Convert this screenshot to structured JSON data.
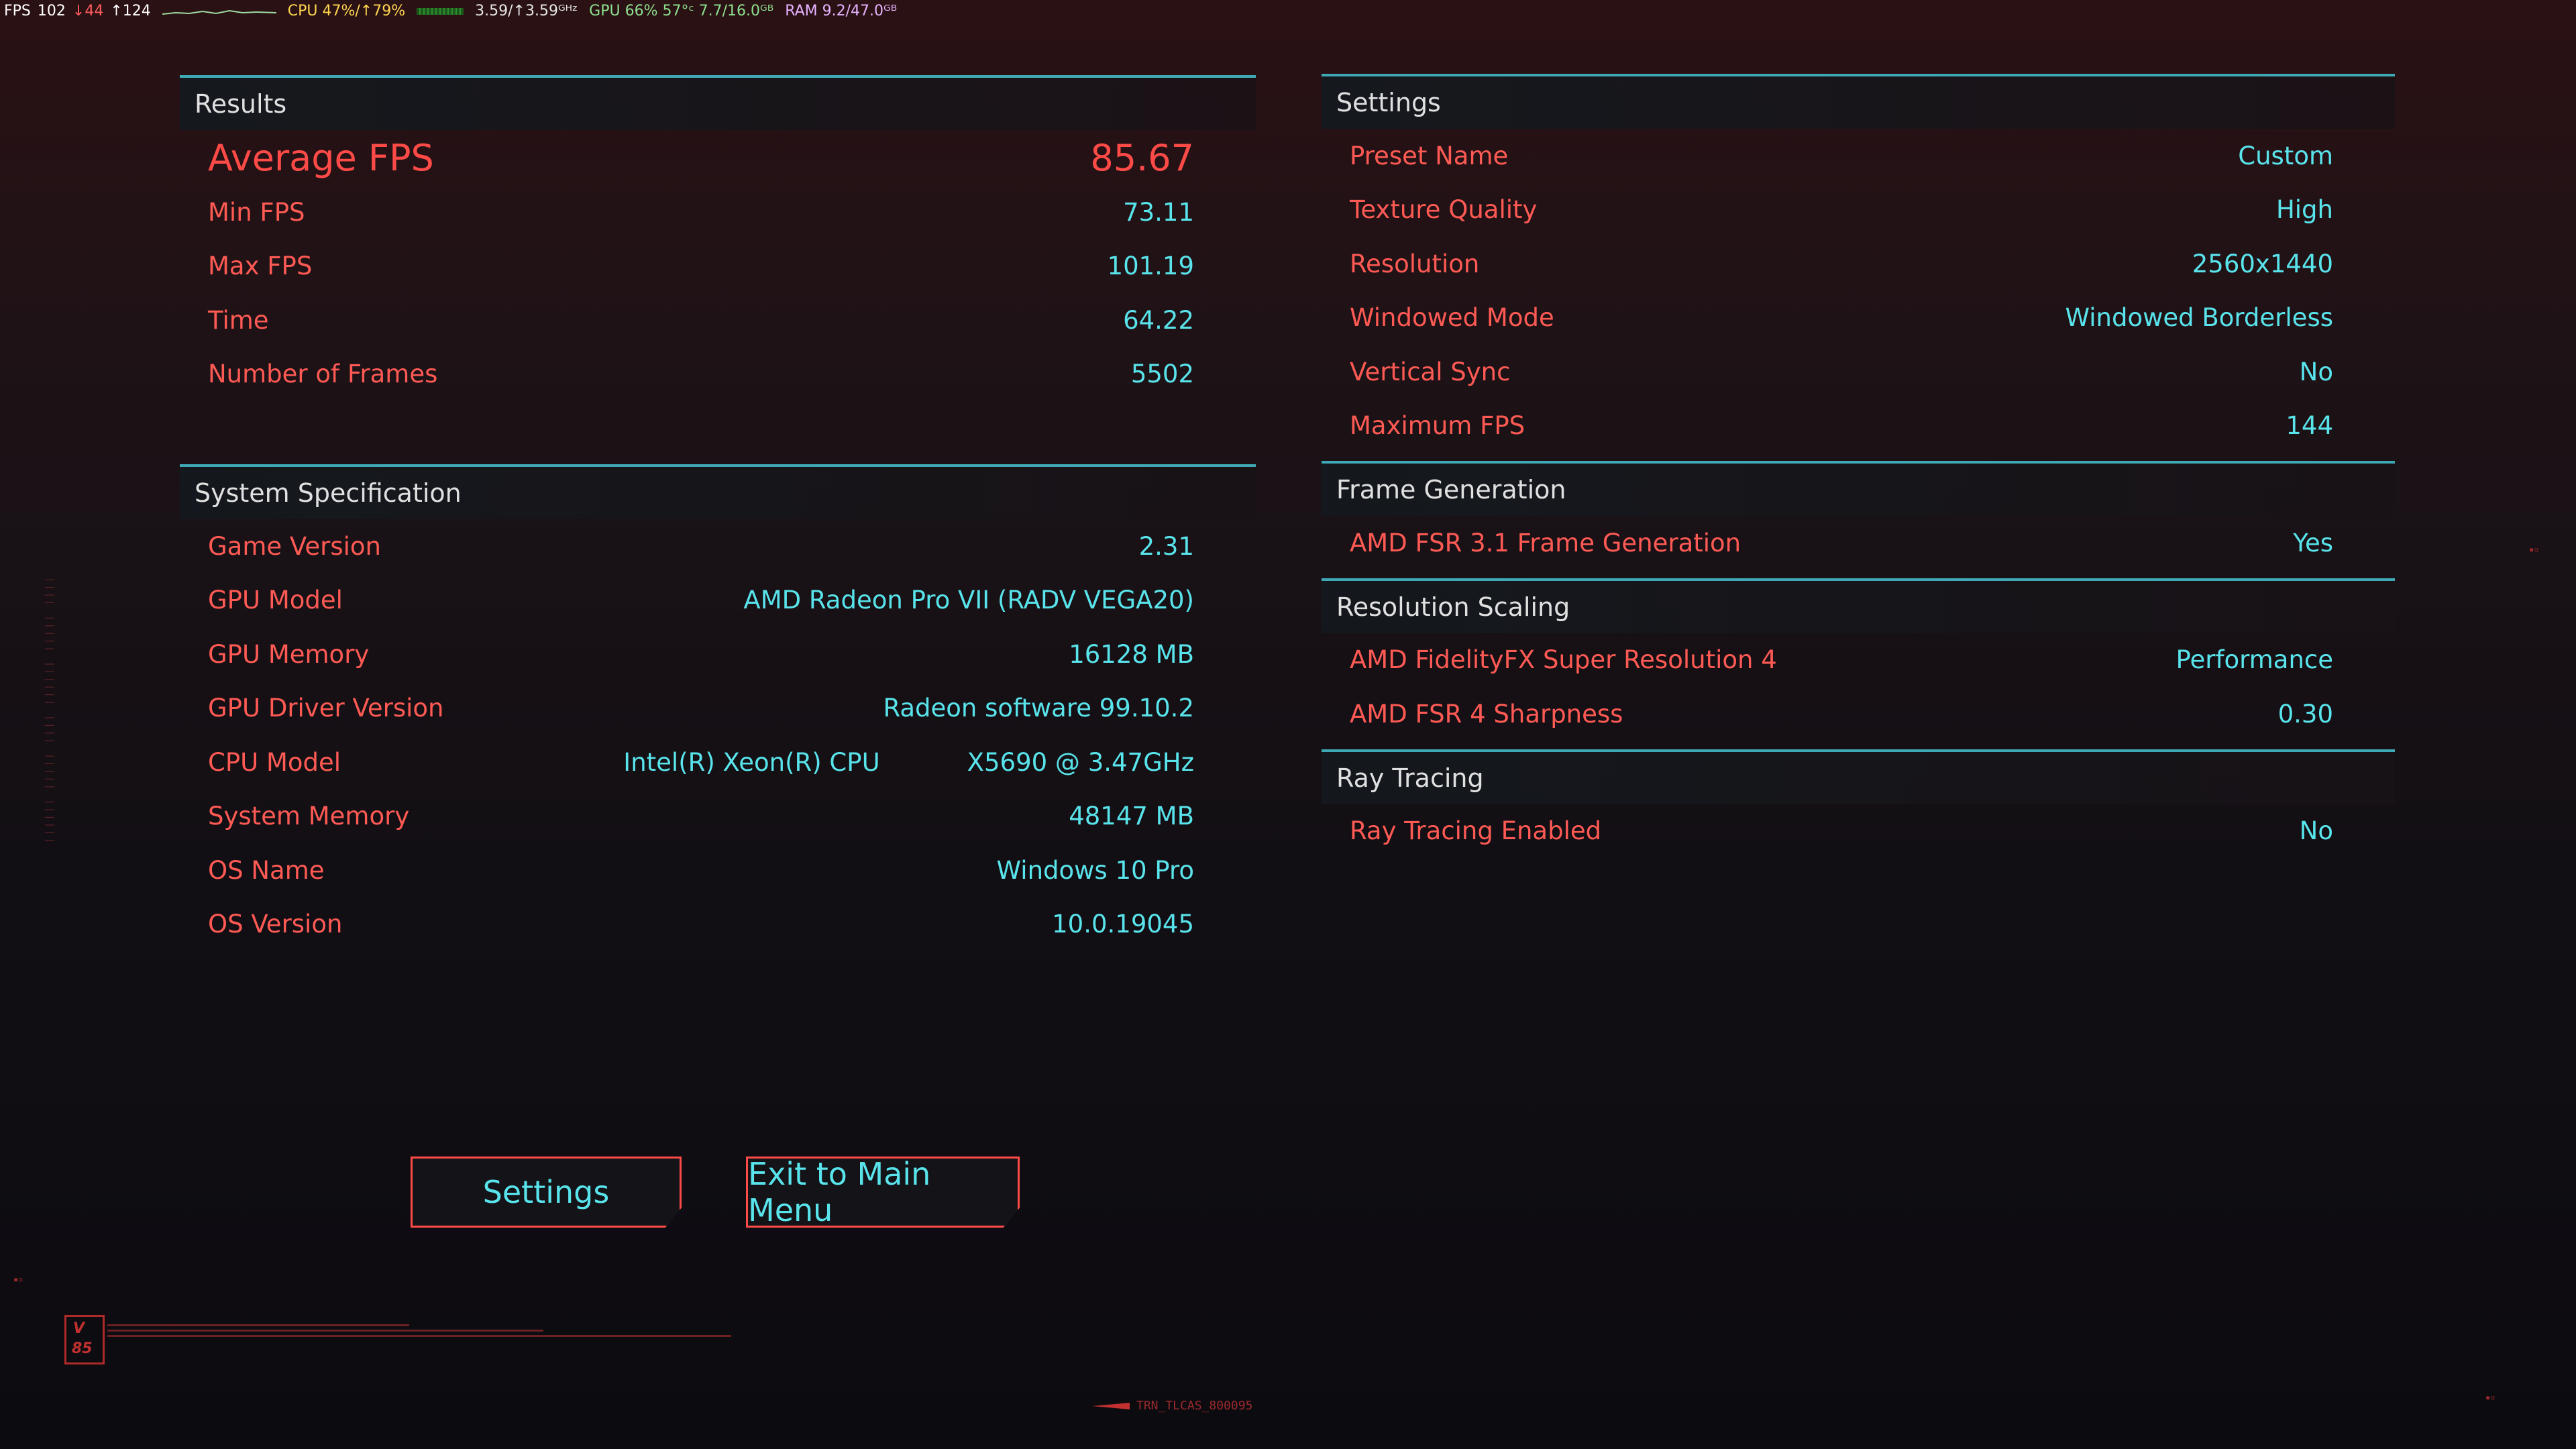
{
  "overlay": {
    "fps_label": "FPS",
    "fps": "102",
    "fps_low": "↓44",
    "fps_high": "↑124",
    "cpu": "CPU 47%/↑79%",
    "cpu_clock": "3.59/↑3.59ᴳᴴᶻ",
    "gpu": "GPU 66% 57°ᶜ 7.7/16.0ᴳᴮ",
    "ram": "RAM 9.2/47.0ᴳᴮ"
  },
  "results": {
    "header": "Results",
    "average": {
      "label": "Average FPS",
      "value": "85.67"
    },
    "rows": [
      {
        "label": "Min FPS",
        "value": "73.11"
      },
      {
        "label": "Max FPS",
        "value": "101.19"
      },
      {
        "label": "Time",
        "value": "64.22"
      },
      {
        "label": "Number of Frames",
        "value": "5502"
      }
    ]
  },
  "system": {
    "header": "System Specification",
    "rows": [
      {
        "label": "Game Version",
        "value": "2.31"
      },
      {
        "label": "GPU Model",
        "value": "AMD Radeon Pro VII (RADV VEGA20)"
      },
      {
        "label": "GPU Memory",
        "value": "16128 MB"
      },
      {
        "label": "GPU Driver Version",
        "value": "Radeon software 99.10.2"
      },
      {
        "label": "CPU Model",
        "value_a": "Intel(R) Xeon(R) CPU",
        "value_b": "X5690  @ 3.47GHz"
      },
      {
        "label": "System Memory",
        "value": "48147 MB"
      },
      {
        "label": "OS Name",
        "value": "Windows 10 Pro"
      },
      {
        "label": "OS Version",
        "value": "10.0.19045"
      }
    ]
  },
  "settings": {
    "header": "Settings",
    "rows": [
      {
        "label": "Preset Name",
        "value": "Custom"
      },
      {
        "label": "Texture Quality",
        "value": "High"
      },
      {
        "label": "Resolution",
        "value": "2560x1440"
      },
      {
        "label": "Windowed Mode",
        "value": "Windowed Borderless"
      },
      {
        "label": "Vertical Sync",
        "value": "No"
      },
      {
        "label": "Maximum FPS",
        "value": "144"
      }
    ]
  },
  "frame_generation": {
    "header": "Frame Generation",
    "rows": [
      {
        "label": "AMD FSR 3.1 Frame Generation",
        "value": "Yes"
      }
    ]
  },
  "resolution_scaling": {
    "header": "Resolution Scaling",
    "rows": [
      {
        "label": "AMD FidelityFX Super Resolution 4",
        "value": "Performance"
      },
      {
        "label": "AMD FSR 4 Sharpness",
        "value": "0.30"
      }
    ]
  },
  "ray_tracing": {
    "header": "Ray Tracing",
    "rows": [
      {
        "label": "Ray Tracing Enabled",
        "value": "No"
      }
    ]
  },
  "buttons": {
    "settings": "Settings",
    "exit": "Exit to Main Menu"
  },
  "decor": {
    "logo": "V\n85",
    "bottom_tag": "TRN_TLCAS_800095"
  },
  "colors": {
    "label_red": "#ff5a54",
    "value_cyan": "#59e4ec",
    "accent_teal": "#3ea8b4"
  }
}
